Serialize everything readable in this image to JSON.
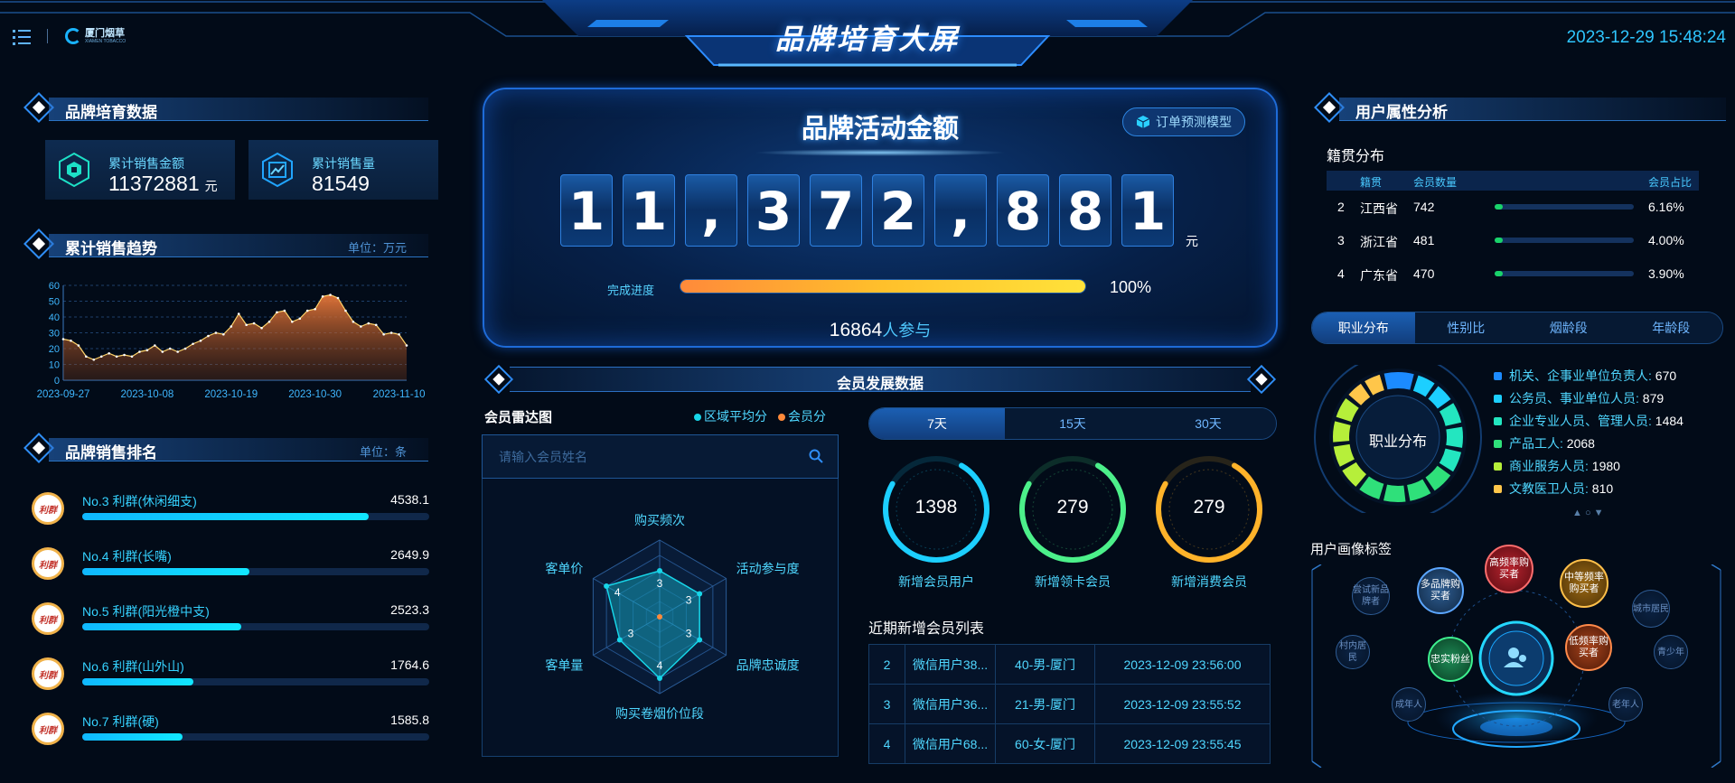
{
  "header": {
    "title": "品牌培育大屏",
    "datetime": "2023-12-29 15:48:24",
    "logo_text": "厦门烟草",
    "logo_sub": "XIAMEN TOBACCO"
  },
  "brand_data": {
    "section_title": "品牌培育数据",
    "cards": [
      {
        "label": "累计销售金额",
        "value": "11372881",
        "unit": "元",
        "icon": "cube-icon"
      },
      {
        "label": "累计销售量",
        "value": "81549",
        "unit": "",
        "icon": "trend-chart-icon"
      }
    ]
  },
  "trend": {
    "section_title": "累计销售趋势",
    "unit": "单位：万元"
  },
  "chart_data": {
    "type": "area",
    "x_ticks": [
      "2023-09-27",
      "2023-10-08",
      "2023-10-19",
      "2023-10-30",
      "2023-11-10"
    ],
    "x_start": "2023-09-27",
    "x_end": "2023-11-11",
    "ylim": [
      0,
      60
    ],
    "y_ticks": [
      0,
      10,
      20,
      30,
      40,
      50,
      60
    ],
    "grid": true,
    "values": [
      26,
      25,
      22,
      15,
      13,
      15,
      17,
      15,
      16,
      15,
      18,
      19,
      22,
      18,
      20,
      18,
      20,
      23,
      25,
      28,
      30,
      29,
      34,
      42,
      35,
      36,
      33,
      37,
      43,
      44,
      37,
      39,
      44,
      45,
      53,
      54,
      52,
      44,
      37,
      34,
      36,
      35,
      29,
      30,
      29,
      22
    ]
  },
  "ranking": {
    "section_title": "品牌销售排名",
    "unit": "单位：条",
    "badge_text": "利群",
    "max": 5500,
    "items": [
      {
        "name": "No.3 利群(休闲细支)",
        "value": "4538.1",
        "amount": 4538.1
      },
      {
        "name": "No.4 利群(长嘴)",
        "value": "2649.9",
        "amount": 2649.9
      },
      {
        "name": "No.5 利群(阳光橙中支)",
        "value": "2523.3",
        "amount": 2523.3
      },
      {
        "name": "No.6 利群(山外山)",
        "value": "1764.6",
        "amount": 1764.6
      },
      {
        "name": "No.7 利群(硬)",
        "value": "1585.8",
        "amount": 1585.8
      }
    ]
  },
  "activity": {
    "title": "品牌活动金额",
    "predict_button": "订单预测模型",
    "digits": [
      "1",
      "1",
      ",",
      "3",
      "7",
      "2",
      ",",
      "8",
      "8",
      "1"
    ],
    "unit": "元",
    "progress_label": "完成进度",
    "progress_value": 1.0,
    "progress_text": "100%",
    "participants": "16864",
    "participants_suffix": "人参与"
  },
  "member": {
    "section_title": "会员发展数据",
    "radar": {
      "title": "会员雷达图",
      "legend": [
        {
          "name": "区域平均分",
          "color": "#17d6e9"
        },
        {
          "name": "会员分",
          "color": "#ff8a3a"
        }
      ],
      "search_placeholder": "请输入会员姓名",
      "axes": [
        "购买频次",
        "活动参与度",
        "品牌忠诚度",
        "购买卷烟价位段",
        "客单量",
        "客单价"
      ],
      "max": 5,
      "values": [
        3,
        3,
        3,
        4,
        3,
        4
      ],
      "value_labels": [
        "3",
        "3",
        "3",
        "4",
        "3",
        "4"
      ]
    },
    "day_tabs": [
      "7天",
      "15天",
      "30天"
    ],
    "rings": [
      {
        "value": "1398",
        "label": "新增会员用户",
        "color": "#1ccfff",
        "fraction": 0.75
      },
      {
        "value": "279",
        "label": "新增领卡会员",
        "color": "#4cf08a",
        "fraction": 0.75
      },
      {
        "value": "279",
        "label": "新增消费会员",
        "color": "#ffb32a",
        "fraction": 0.75
      }
    ],
    "recent_title": "近期新增会员列表",
    "recent": [
      [
        "2",
        "微信用户38...",
        "40-男-厦门",
        "2023-12-09 23:56:00"
      ],
      [
        "3",
        "微信用户36...",
        "21-男-厦门",
        "2023-12-09 23:55:52"
      ],
      [
        "4",
        "微信用户68...",
        "60-女-厦门",
        "2023-12-09 23:55:45"
      ]
    ]
  },
  "user_attr": {
    "section_title": "用户属性分析",
    "origin_title": "籍贯分布",
    "origin_head": [
      "籍贯",
      "会员数量",
      "会员占比"
    ],
    "origin_rows": [
      {
        "rank": "2",
        "province": "江西省",
        "count": "742",
        "pct": "6.16%",
        "fraction": 0.0616
      },
      {
        "rank": "3",
        "province": "浙江省",
        "count": "481",
        "pct": "4.00%",
        "fraction": 0.04
      },
      {
        "rank": "4",
        "province": "广东省",
        "count": "470",
        "pct": "3.90%",
        "fraction": 0.039
      }
    ],
    "tabs": [
      "职业分布",
      "性别比",
      "烟龄段",
      "年龄段"
    ],
    "donut_label": "职业分布",
    "occupations": [
      {
        "name": "机关、企事业单位负责人",
        "value": "670",
        "color": "#1c8bff"
      },
      {
        "name": "公务员、事业单位人员",
        "value": "879",
        "color": "#1ccfff"
      },
      {
        "name": "企业专业人员、管理人员",
        "value": "1484",
        "color": "#23e6c0"
      },
      {
        "name": "产品工人",
        "value": "2068",
        "color": "#2fe07a"
      },
      {
        "name": "商业服务人员",
        "value": "1980",
        "color": "#b6ef3a"
      },
      {
        "name": "文教医卫人员",
        "value": "810",
        "color": "#ffc64a"
      }
    ],
    "pager": "▲ ○ ▼",
    "portrait_title": "用户画像标签",
    "tags": [
      "高频率购买者",
      "中等频率购买者",
      "多品牌购买者",
      "低频率购买者",
      "忠实粉丝",
      "尝试新品牌者",
      "城市居民",
      "村内居民",
      "青少年",
      "成年人",
      "老年人"
    ]
  }
}
